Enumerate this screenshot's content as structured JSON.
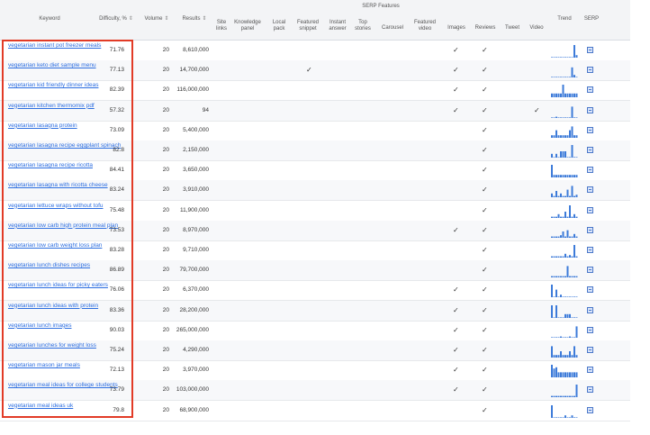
{
  "headers": {
    "keyword": "Keyword",
    "difficulty": "Difficulty, %",
    "volume": "Volume",
    "results": "Results",
    "serp_features": "SERP Features",
    "site_links": "Site links",
    "knowledge_panel": "Knowledge panel",
    "local_pack": "Local pack",
    "featured_snippet": "Featured snippet",
    "instant_answer": "Instant answer",
    "top_stories": "Top stories",
    "carousel": "Carousel",
    "featured_video": "Featured video",
    "images": "Images",
    "reviews": "Reviews",
    "tweet": "Tweet",
    "video": "Video",
    "trend": "Trend",
    "serp": "SERP",
    "sort_icon": "⇕"
  },
  "check_glyph": "✓",
  "colors": {
    "link": "#2b6de0",
    "trend": "#3d7bd9",
    "highlight": "#e23b26"
  },
  "rows": [
    {
      "keyword": "vegetarian instant pot freezer meals",
      "difficulty": "71.76",
      "volume": "20",
      "results": "8,610,000",
      "featured_snippet": false,
      "images": true,
      "reviews": true,
      "video": false,
      "trend": [
        0,
        0,
        0,
        0,
        0,
        0,
        0,
        0,
        0,
        0,
        1,
        0.2
      ]
    },
    {
      "keyword": "vegetarian keto diet sample menu",
      "difficulty": "77.13",
      "volume": "20",
      "results": "14,700,000",
      "featured_snippet": true,
      "images": true,
      "reviews": true,
      "video": false,
      "trend": [
        0,
        0,
        0,
        0,
        0,
        0,
        0,
        0,
        0,
        0.8,
        0.2,
        0
      ]
    },
    {
      "keyword": "vegetarian kid friendly dinner ideas",
      "difficulty": "82.39",
      "volume": "20",
      "results": "116,000,000",
      "featured_snippet": false,
      "images": true,
      "reviews": true,
      "video": false,
      "trend": [
        0.3,
        0.3,
        0.3,
        0.3,
        0.3,
        1,
        0.3,
        0.3,
        0.3,
        0.3,
        0.3,
        0.3
      ]
    },
    {
      "keyword": "vegetarian kitchen thermomix pdf",
      "difficulty": "57.32",
      "volume": "20",
      "results": "94",
      "featured_snippet": false,
      "images": true,
      "reviews": true,
      "video": true,
      "trend": [
        0,
        0,
        0.1,
        0,
        0,
        0,
        0,
        0,
        0,
        0.9,
        0,
        0
      ]
    },
    {
      "keyword": "vegetarian lasagna protein",
      "difficulty": "73.09",
      "volume": "20",
      "results": "5,400,000",
      "featured_snippet": false,
      "images": false,
      "reviews": true,
      "video": false,
      "trend": [
        0.2,
        0.2,
        0.6,
        0.2,
        0.2,
        0.2,
        0.2,
        0.2,
        0.6,
        0.9,
        0.2,
        0.2
      ]
    },
    {
      "keyword": "vegetarian lasagna recipe eggplant spinach",
      "difficulty": "82.8",
      "volume": "20",
      "results": "2,150,000",
      "featured_snippet": false,
      "images": false,
      "reviews": true,
      "video": false,
      "trend": [
        0.3,
        0,
        0.3,
        0,
        0.5,
        0.5,
        0.5,
        0,
        0,
        1,
        0,
        0
      ]
    },
    {
      "keyword": "vegetarian lasagna recipe ricotta",
      "difficulty": "84.41",
      "volume": "20",
      "results": "3,650,000",
      "featured_snippet": false,
      "images": false,
      "reviews": true,
      "video": false,
      "trend": [
        1,
        0.2,
        0.2,
        0.2,
        0.2,
        0.2,
        0.2,
        0.2,
        0.2,
        0.2,
        0.2,
        0.2
      ]
    },
    {
      "keyword": "vegetarian lasagna with ricotta cheese",
      "difficulty": "83.24",
      "volume": "20",
      "results": "3,910,000",
      "featured_snippet": false,
      "images": false,
      "reviews": true,
      "video": false,
      "trend": [
        0.3,
        0.1,
        0.5,
        0.1,
        0.3,
        0.1,
        0.1,
        0.6,
        0.1,
        0.9,
        0.1,
        0.2
      ]
    },
    {
      "keyword": "vegetarian lettuce wraps without tofu",
      "difficulty": "75.48",
      "volume": "20",
      "results": "11,900,000",
      "featured_snippet": false,
      "images": false,
      "reviews": true,
      "video": false,
      "trend": [
        0.1,
        0.1,
        0.1,
        0.3,
        0.1,
        0.1,
        0.5,
        0.1,
        1,
        0.1,
        0.3,
        0.1
      ]
    },
    {
      "keyword": "vegetarian low carb high protein meal plan",
      "difficulty": "73.53",
      "volume": "20",
      "results": "8,970,000",
      "featured_snippet": false,
      "images": true,
      "reviews": true,
      "video": false,
      "trend": [
        0.1,
        0.1,
        0.1,
        0.1,
        0.2,
        0.5,
        0.1,
        0.6,
        0.1,
        0.1,
        0.3,
        0.1
      ]
    },
    {
      "keyword": "vegetarian low carb weight loss plan",
      "difficulty": "83.28",
      "volume": "20",
      "results": "9,710,000",
      "featured_snippet": false,
      "images": false,
      "reviews": true,
      "video": false,
      "trend": [
        0.1,
        0.1,
        0.1,
        0.1,
        0.1,
        0.1,
        0.3,
        0.1,
        0.2,
        0.1,
        1,
        0.1
      ]
    },
    {
      "keyword": "vegetarian lunch dishes recipes",
      "difficulty": "86.89",
      "volume": "20",
      "results": "79,700,000",
      "featured_snippet": false,
      "images": false,
      "reviews": true,
      "video": false,
      "trend": [
        0.1,
        0.1,
        0.1,
        0.1,
        0.1,
        0.1,
        0.1,
        0.9,
        0.1,
        0.1,
        0.1,
        0.1
      ]
    },
    {
      "keyword": "vegetarian lunch ideas for picky eaters",
      "difficulty": "76.06",
      "volume": "20",
      "results": "6,370,000",
      "featured_snippet": false,
      "images": true,
      "reviews": true,
      "video": false,
      "trend": [
        1,
        0,
        0.6,
        0,
        0.2,
        0,
        0,
        0,
        0,
        0,
        0,
        0
      ]
    },
    {
      "keyword": "vegetarian lunch ideas with protein",
      "difficulty": "83.36",
      "volume": "20",
      "results": "28,200,000",
      "featured_snippet": false,
      "images": true,
      "reviews": true,
      "video": false,
      "trend": [
        1,
        0,
        1,
        0,
        0,
        0,
        0.3,
        0.3,
        0.3,
        0,
        0,
        0
      ]
    },
    {
      "keyword": "vegetarian lunch images",
      "difficulty": "90.03",
      "volume": "20",
      "results": "265,000,000",
      "featured_snippet": false,
      "images": true,
      "reviews": true,
      "video": false,
      "trend": [
        0,
        0,
        0,
        0,
        0.1,
        0,
        0,
        0,
        0.1,
        0,
        0,
        0.9
      ]
    },
    {
      "keyword": "vegetarian lunches for weight loss",
      "difficulty": "75.24",
      "volume": "20",
      "results": "4,290,000",
      "featured_snippet": false,
      "images": true,
      "reviews": true,
      "video": false,
      "trend": [
        0.9,
        0.2,
        0.2,
        0.2,
        0.5,
        0.2,
        0.2,
        0.2,
        0.5,
        0.2,
        0.9,
        0.2
      ]
    },
    {
      "keyword": "vegetarian mason jar meals",
      "difficulty": "72.13",
      "volume": "20",
      "results": "3,970,000",
      "featured_snippet": false,
      "images": true,
      "reviews": true,
      "video": false,
      "trend": [
        1,
        0.7,
        0.8,
        0.4,
        0.4,
        0.4,
        0.4,
        0.4,
        0.4,
        0.4,
        0.4,
        0.4
      ]
    },
    {
      "keyword": "vegetarian meal ideas for college students",
      "difficulty": "73.79",
      "volume": "20",
      "results": "103,000,000",
      "featured_snippet": false,
      "images": true,
      "reviews": true,
      "video": false,
      "trend": [
        0.1,
        0.1,
        0.1,
        0.1,
        0.1,
        0.1,
        0.1,
        0.1,
        0.1,
        0.1,
        0.1,
        1
      ]
    },
    {
      "keyword": "vegetarian meal ideas uk",
      "difficulty": "79.8",
      "volume": "20",
      "results": "68,900,000",
      "featured_snippet": false,
      "images": false,
      "reviews": true,
      "video": false,
      "trend": [
        1,
        0,
        0,
        0,
        0,
        0,
        0.2,
        0,
        0,
        0.2,
        0,
        0
      ]
    }
  ]
}
